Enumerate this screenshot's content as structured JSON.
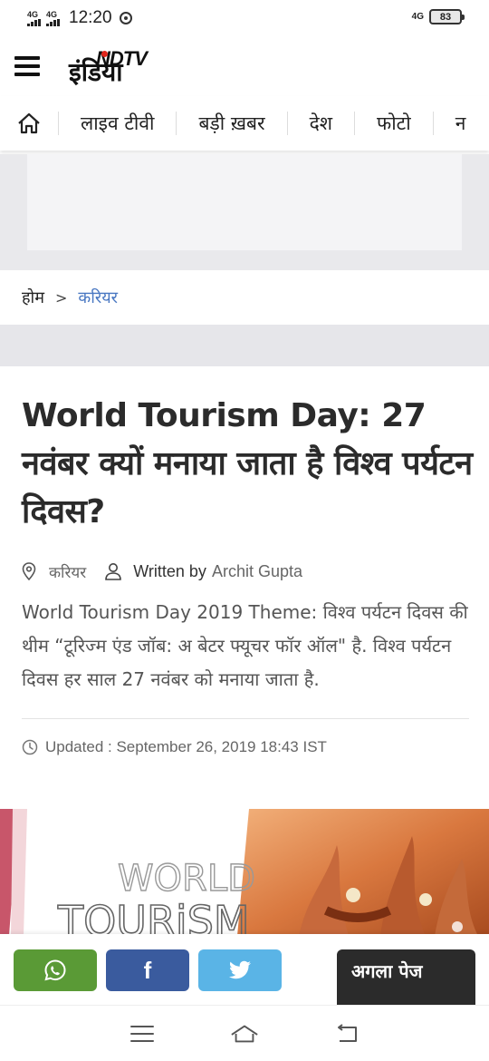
{
  "status_bar": {
    "network_1": "4G",
    "network_2": "4G",
    "time": "12:20",
    "network_right": "4G",
    "battery": "83"
  },
  "header": {
    "logo_text_en": "NDTV",
    "logo_text_hi": "इंडिया"
  },
  "nav": {
    "items": [
      {
        "label": "लाइव टीवी"
      },
      {
        "label": "बड़ी ख़बर"
      },
      {
        "label": "देश"
      },
      {
        "label": "फोटो"
      },
      {
        "label": "न"
      }
    ]
  },
  "breadcrumb": {
    "home": "होम",
    "separator": ">",
    "current": "करियर"
  },
  "article": {
    "title": "World Tourism Day: 27 नवंबर क्यों मनाया जाता है विश्व पर्यटन दिवस?",
    "category": "करियर",
    "written_by": "Written by",
    "author": "Archit Gupta",
    "summary": "World Tourism Day 2019 Theme: विश्व पर्यटन दिवस की थीम “टूरिज्म एंड जॉब: अ बेटर फ्यूचर फॉर ऑल\" है. विश्व पर्यटन दिवस हर साल 27 नवंबर को मनाया जाता है.",
    "updated": "Updated : September 26, 2019 18:43 IST"
  },
  "hero": {
    "text_line1": "WORLD",
    "text_line2": "TOURiSM"
  },
  "share_bar": {
    "facebook_label": "f",
    "next_page": "अगला पेज"
  },
  "icons": {
    "whatsapp": "whatsapp-icon",
    "facebook": "facebook-icon",
    "twitter": "twitter-icon",
    "home": "home-icon",
    "location": "location-pin-icon",
    "user": "user-icon",
    "clock": "clock-icon"
  },
  "colors": {
    "breadcrumb_link": "#4a78c2",
    "whatsapp": "#5a9a36",
    "facebook": "#3a5b9e",
    "twitter": "#5ab4e6",
    "next_page_bg": "#2b2b2b",
    "logo_accent": "#e1261c"
  }
}
